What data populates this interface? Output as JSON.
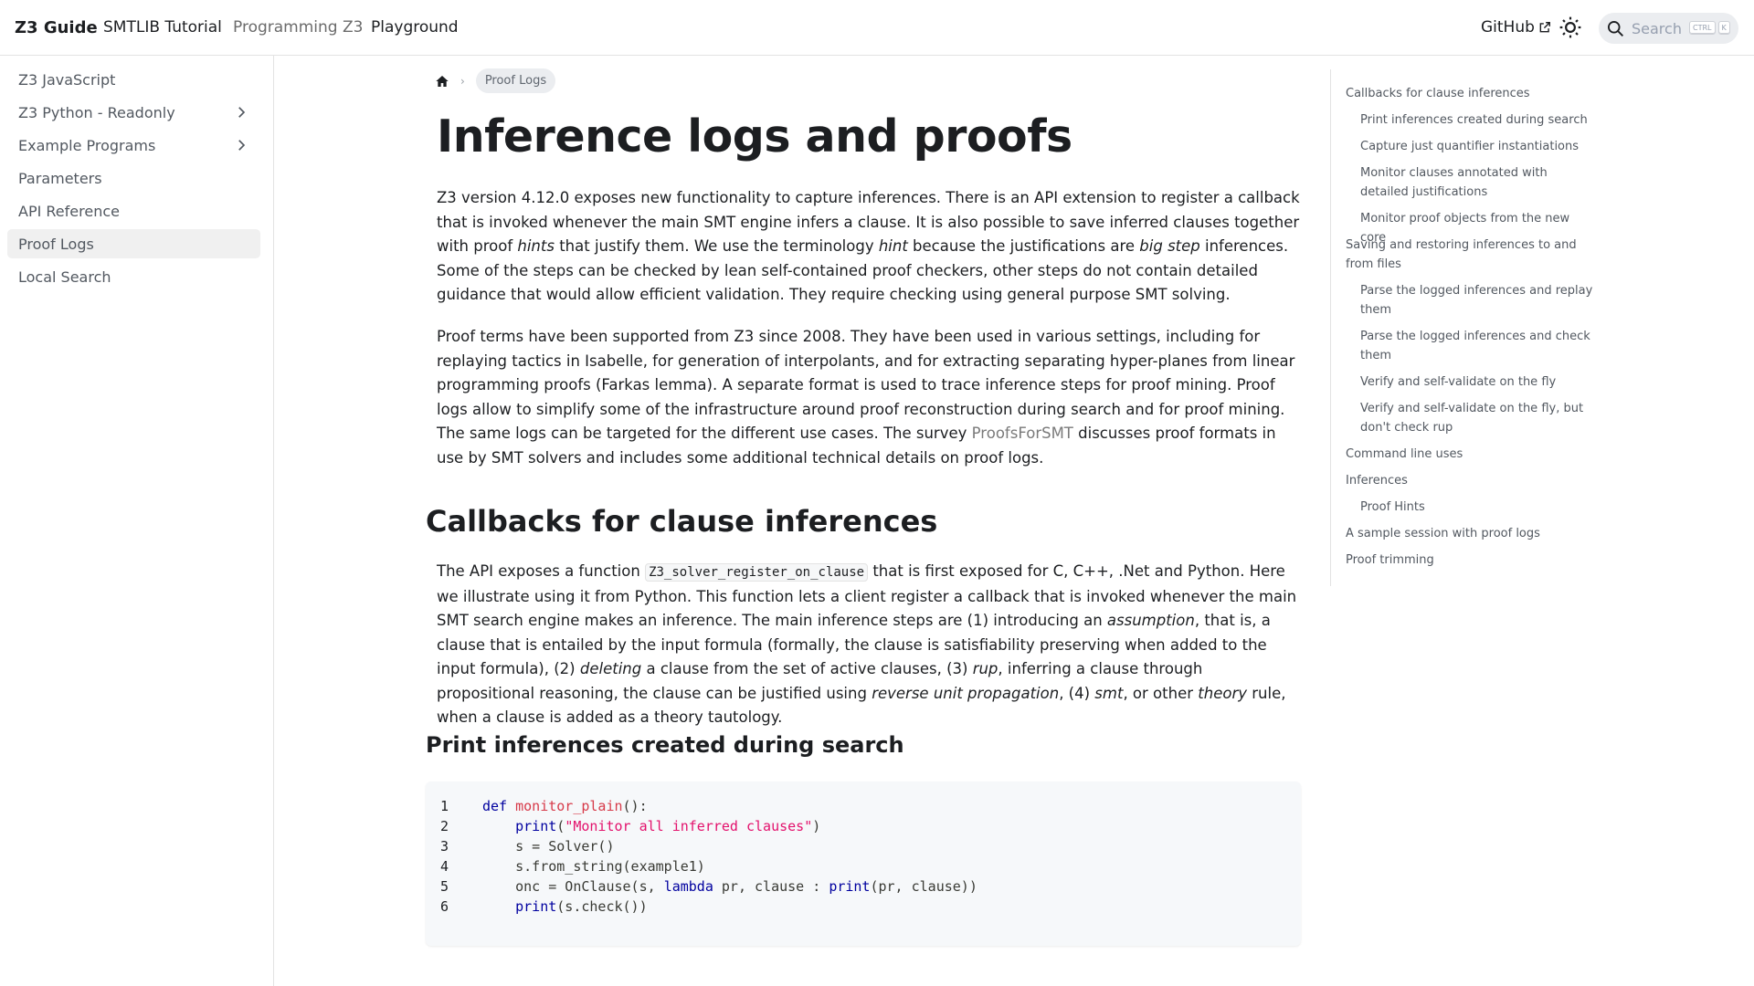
{
  "navbar": {
    "brand": "Z3 Guide",
    "links": [
      "SMTLIB Tutorial",
      "Programming Z3",
      "Playground"
    ],
    "github": "GitHub",
    "search": {
      "placeholder": "Search",
      "shortcut": [
        "CTRL",
        "K"
      ]
    }
  },
  "sidebar": {
    "items": [
      {
        "label": "Z3 JavaScript",
        "expandable": false,
        "active": false
      },
      {
        "label": "Z3 Python - Readonly",
        "expandable": true,
        "active": false
      },
      {
        "label": "Example Programs",
        "expandable": true,
        "active": false
      },
      {
        "label": "Parameters",
        "expandable": false,
        "active": false
      },
      {
        "label": "API Reference",
        "expandable": false,
        "active": false
      },
      {
        "label": "Proof Logs",
        "expandable": false,
        "active": true
      },
      {
        "label": "Local Search",
        "expandable": false,
        "active": false
      }
    ]
  },
  "breadcrumb": {
    "current": "Proof Logs"
  },
  "page": {
    "title": "Inference logs and proofs",
    "intro": {
      "p1a": "Z3 version 4.12.0 exposes new functionality to capture inferences. There is an API extension to register a callback that is invoked whenever the main SMT engine infers a clause. It is also possible to save inferred clauses together with proof ",
      "p1_em1": "hints",
      "p1b": " that justify them. We use the terminology ",
      "p1_em2": "hint",
      "p1c": " because the justifications are ",
      "p1_em3": "big step",
      "p1d": " inferences. Some of the steps can be checked by lean self-contained proof checkers, other steps do not contain detailed guidance that would allow efficient validation. They require checking using general purpose SMT solving.",
      "p2a": "Proof terms have been supported from Z3 since 2008. They have been used in various settings, including for replaying tactics in Isabelle, for generation of interpolants, and for extracting separating hyper-planes from linear programming proofs (Farkas lemma). A separate format is used to trace inference steps for proof mining. Proof logs allow to simplify some of the infrastructure around proof reconstruction during search and for proof mining. The same logs can be targeted for the different use cases. The survey ",
      "p2_link": "ProofsForSMT",
      "p2b": " discusses proof formats in use by SMT solvers and includes some additional technical details on proof logs."
    },
    "section1": {
      "heading": "Callbacks for clause inferences",
      "t1": "The API exposes a function ",
      "code": "Z3_solver_register_on_clause",
      "t2": " that is first exposed for C, C++, .Net and Python. Here we illustrate using it from Python. This function lets a client register a callback that is invoked whenever the main SMT search engine makes an inference. The main inference steps are (1) introducing an ",
      "e1": "assumption",
      "t3": ", that is, a clause that is entailed by the input formula (formally, the clause is satisfiability preserving when added to the input formula), (2) ",
      "e2": "deleting",
      "t4": " a clause from the set of active clauses, (3) ",
      "e3": "rup",
      "t5": ", inferring a clause through propositional reasoning, the clause can be justified using ",
      "e4": "reverse unit propagation",
      "t6": ", (4) ",
      "e5": "smt",
      "t7": ", or other ",
      "e6": "theory",
      "t8": " rule, when a clause is added as a theory tautology."
    },
    "subsection1": {
      "heading": "Print inferences created during search"
    },
    "code": {
      "line_numbers": [
        "1",
        "2",
        "3",
        "4",
        "5",
        "6"
      ],
      "l1": {
        "kw": "def",
        "fn": "monitor_plain",
        "rest": "():"
      },
      "l2": {
        "indent": "    ",
        "fn": "print",
        "open": "(",
        "str": "\"Monitor all inferred clauses\"",
        "close": ")"
      },
      "l3": {
        "text": "    s = Solver()"
      },
      "l4": {
        "text": "    s.from_string(example1)"
      },
      "l5": {
        "pre": "    onc = OnClause(s, ",
        "kw": "lambda",
        "mid": " pr, clause : ",
        "fn": "print",
        "post": "(pr, clause))"
      },
      "l6": {
        "indent": "    ",
        "fn": "print",
        "post": "(s.check())"
      }
    }
  },
  "toc": [
    {
      "label": "Callbacks for clause inferences",
      "level": 1
    },
    {
      "label": "Print inferences created during search",
      "level": 2
    },
    {
      "label": "Capture just quantifier instantiations",
      "level": 2
    },
    {
      "label": "Monitor clauses annotated with detailed justifications",
      "level": 2
    },
    {
      "label": "Monitor proof objects from the new core",
      "level": 2
    },
    {
      "label": "Saving and restoring inferences to and from files",
      "level": 1
    },
    {
      "label": "Parse the logged inferences and replay them",
      "level": 2
    },
    {
      "label": "Parse the logged inferences and check them",
      "level": 2
    },
    {
      "label": "Verify and self-validate on the fly",
      "level": 2
    },
    {
      "label": "Verify and self-validate on the fly, but don't check rup",
      "level": 2
    },
    {
      "label": "Command line uses",
      "level": 1
    },
    {
      "label": "Inferences",
      "level": 1
    },
    {
      "label": "Proof Hints",
      "level": 2
    },
    {
      "label": "A sample session with proof logs",
      "level": 1
    },
    {
      "label": "Proof trimming",
      "level": 1
    }
  ]
}
